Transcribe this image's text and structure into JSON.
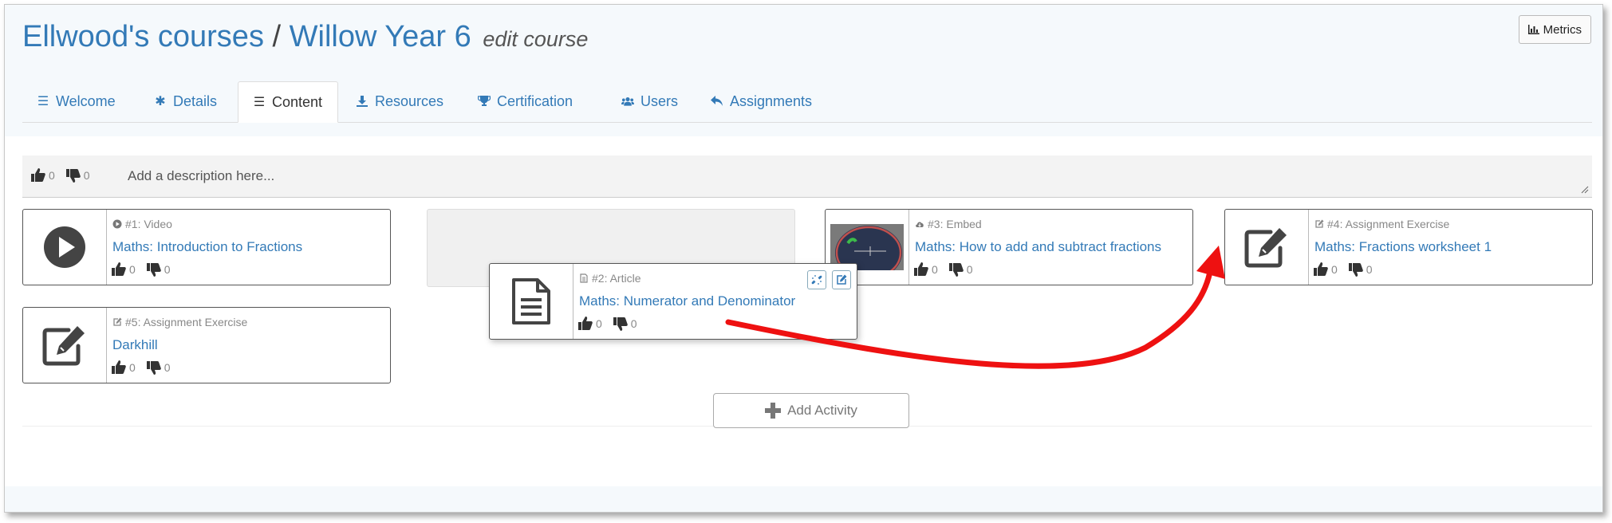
{
  "header": {
    "breadcrumb_courses": "Ellwood's courses",
    "separator": "/",
    "course_name": "Willow Year 6",
    "subtitle": "edit course",
    "metrics_label": "Metrics"
  },
  "tabs": [
    {
      "label": "Welcome",
      "icon": "list-icon"
    },
    {
      "label": "Details",
      "icon": "asterisk-icon"
    },
    {
      "label": "Content",
      "icon": "list-icon",
      "active": true
    },
    {
      "label": "Resources",
      "icon": "download-icon"
    },
    {
      "label": "Certification",
      "icon": "trophy-icon"
    },
    {
      "label": "Users",
      "icon": "users-icon"
    },
    {
      "label": "Assignments",
      "icon": "reply-icon"
    }
  ],
  "description": {
    "placeholder": "Add a description here...",
    "likes": "0",
    "dislikes": "0"
  },
  "activities": [
    {
      "meta": "#1: Video",
      "title": "Maths: Introduction to Fractions",
      "likes": "0",
      "dislikes": "0",
      "icon": "play-icon"
    },
    {
      "meta": "#2: Article",
      "title": "Maths: Numerator and Denominator",
      "likes": "0",
      "dislikes": "0",
      "icon": "document-icon",
      "state": "being-dragged"
    },
    {
      "meta": "#3: Embed",
      "title": "Maths: How to add and subtract fractions",
      "likes": "0",
      "dislikes": "0",
      "icon": "cloud-icon"
    },
    {
      "meta": "#4: Assignment Exercise",
      "title": "Maths: Fractions worksheet 1",
      "likes": "0",
      "dislikes": "0",
      "icon": "edit-icon"
    },
    {
      "meta": "#5: Assignment Exercise",
      "title": "Darkhill",
      "likes": "0",
      "dislikes": "0",
      "icon": "edit-icon"
    }
  ],
  "add_activity_label": "Add Activity",
  "colors": {
    "link": "#337ab7",
    "arrow": "#ee1111",
    "header_bg": "#f5f9fc"
  }
}
